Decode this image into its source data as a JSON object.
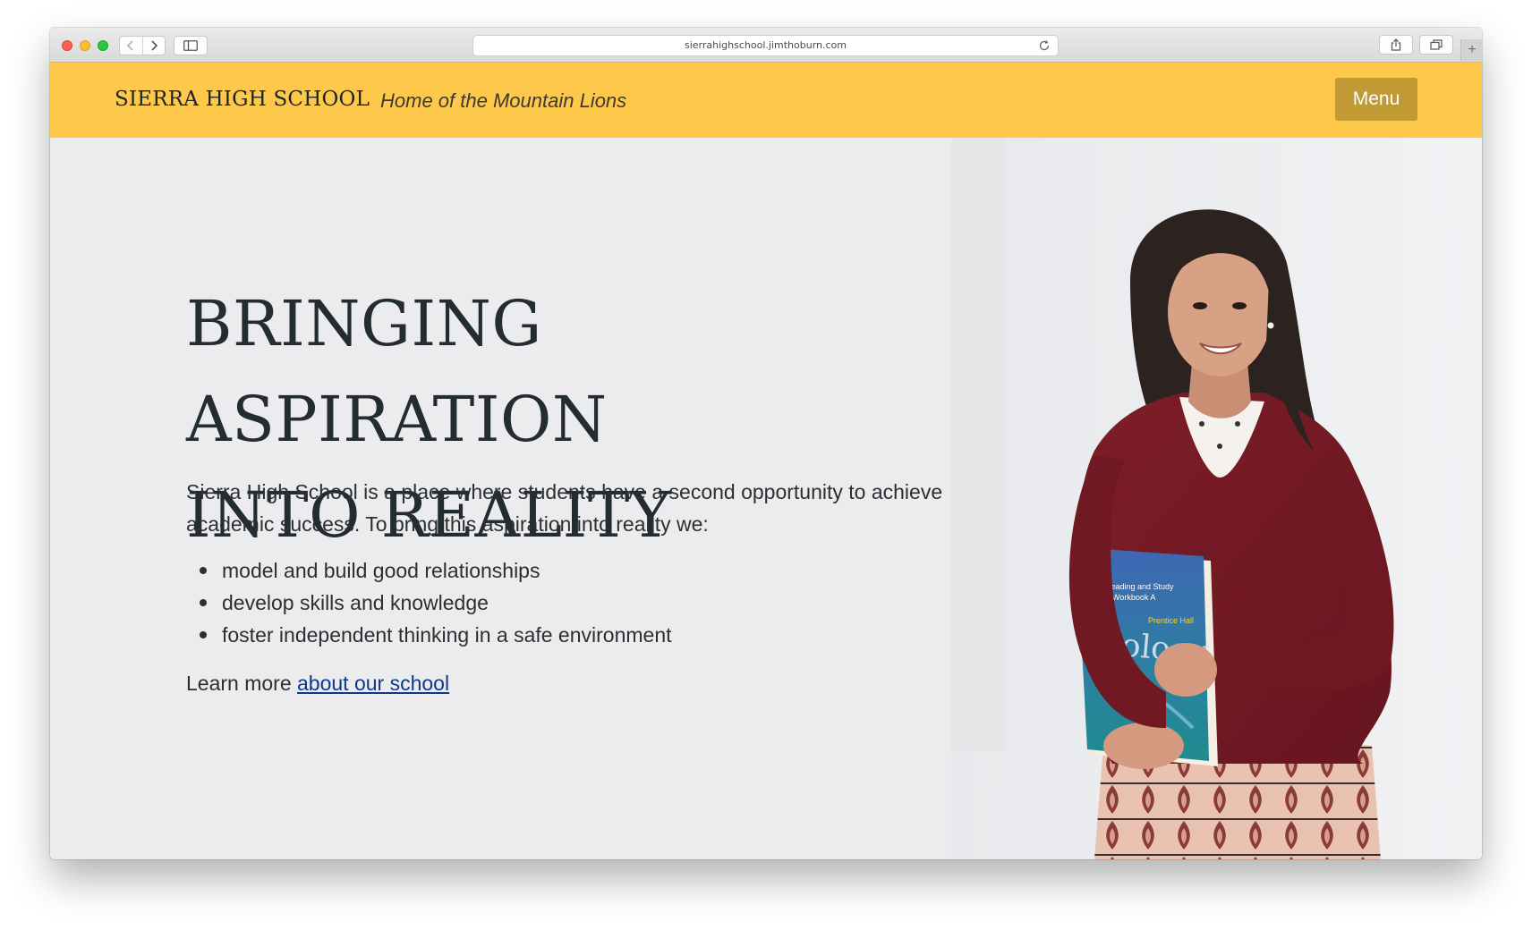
{
  "browser": {
    "url": "sierrahighschool.jimthoburn.com"
  },
  "header": {
    "site_title": "SIERRA HIGH SCHOOL",
    "tagline": "Home of the Mountain Lions",
    "menu_label": "Menu",
    "background_color": "#fec84a",
    "menu_color": "#c29a33"
  },
  "hero": {
    "headline_line1": "BRINGING ASPIRATION",
    "headline_line2": "INTO REALITY",
    "intro": "Sierra High School is a place where students have a second opportunity to achieve academic success. To bring this aspiration into reality we:",
    "bullets": [
      "model and build good relationships",
      "develop skills and knowledge",
      "foster independent thinking in a safe environment"
    ],
    "learn_prefix": "Learn more",
    "learn_link": "about our school",
    "book_title": "Biology",
    "book_subtitle": "Reading and Study Workbook A",
    "book_publisher": "Prentice Hall"
  }
}
